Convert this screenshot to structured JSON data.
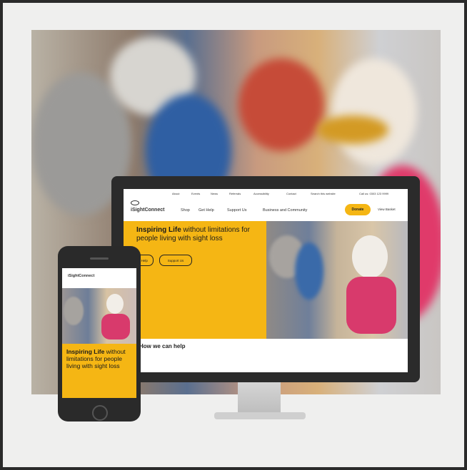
{
  "site": {
    "logo_text": "iSightConnect",
    "top_links": [
      "About",
      "Events",
      "News",
      "Referrals",
      "Accessibility",
      "Contact",
      "Search this website",
      "Call us: 0303 123 9999"
    ],
    "nav": [
      "Shop",
      "Get Help",
      "Support Us",
      "Business and Community"
    ],
    "donate_label": "Donate",
    "view_label": "View Basket"
  },
  "desktop": {
    "headline_bold": "Inspiring Life",
    "headline_rest": " without limitations for people living with sight loss",
    "button_help": "Get Help",
    "button_support": "Support Us",
    "section_title": "How we can help"
  },
  "phone": {
    "headline_bold": "Inspiring Life",
    "headline_rest": " without limitations for people living with sight loss"
  },
  "colors": {
    "brand_yellow": "#f5b614",
    "device_dark": "#2b2b2b",
    "background": "#efefee"
  }
}
